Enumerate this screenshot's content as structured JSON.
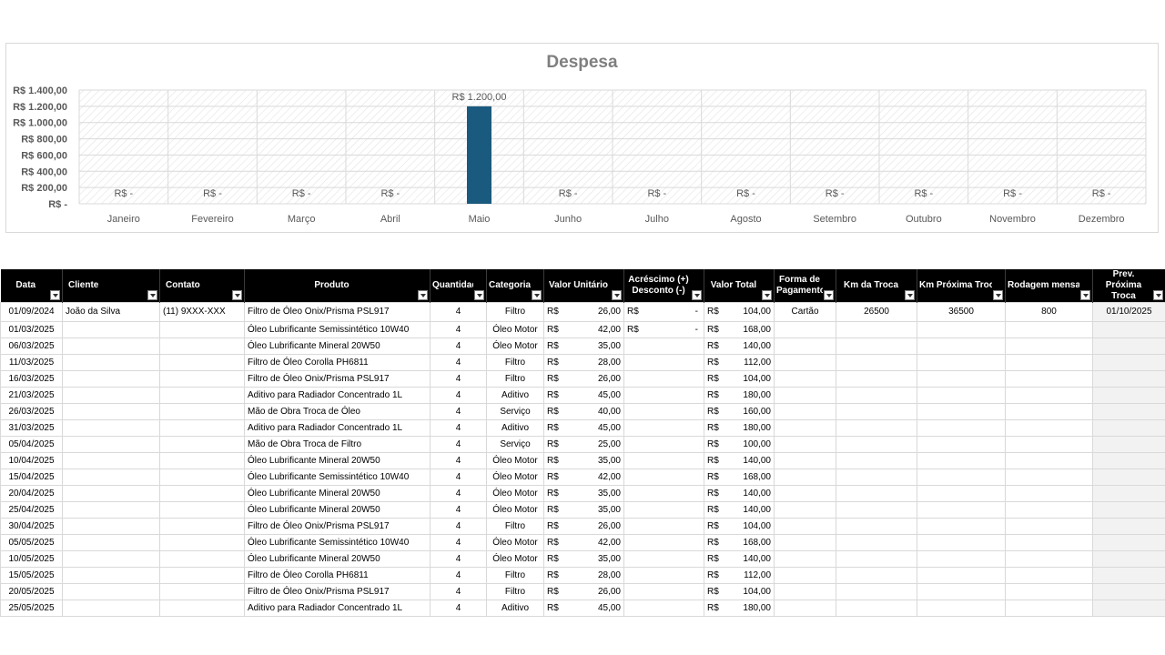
{
  "chart": {
    "title": "Despesa",
    "colors": {
      "bar": "#1a5a7e",
      "grid": "#d9d9d9",
      "text": "#595959",
      "title": "#7f7f7f"
    }
  },
  "chart_data": {
    "type": "bar",
    "title": "Despesa",
    "categories": [
      "Janeiro",
      "Fevereiro",
      "Março",
      "Abril",
      "Maio",
      "Junho",
      "Julho",
      "Agosto",
      "Setembro",
      "Outubro",
      "Novembro",
      "Dezembro"
    ],
    "values": [
      0,
      0,
      0,
      0,
      1200,
      0,
      0,
      0,
      0,
      0,
      0,
      0
    ],
    "data_labels": [
      "R$ -",
      "R$ -",
      "R$ -",
      "R$ -",
      "R$ 1.200,00",
      "R$ -",
      "R$ -",
      "R$ -",
      "R$ -",
      "R$ -",
      "R$ -",
      "R$ -"
    ],
    "y_ticks": [
      0,
      200,
      400,
      600,
      800,
      1000,
      1200,
      1400
    ],
    "y_tick_labels": [
      "R$ -",
      "R$ 200,00",
      "R$ 400,00",
      "R$ 600,00",
      "R$ 800,00",
      "R$ 1.000,00",
      "R$ 1.200,00",
      "R$ 1.400,00"
    ],
    "ylim": [
      0,
      1400
    ],
    "grid": true,
    "legend": "none"
  },
  "table": {
    "headers": [
      "Data",
      "Cliente",
      "Contato",
      "Produto",
      "Quantidade",
      "Categoria",
      "Valor Unitário",
      "Acréscimo (+) Desconto (-)",
      "Valor Total",
      "Forma de Pagamento",
      "Km da Troca",
      "Km Próxima Troca",
      "Rodagem mensal",
      "Prev. Próxima Troca"
    ],
    "currency": "R$",
    "rows": [
      {
        "data": "01/09/2024",
        "cliente": "João da Silva",
        "contato": "(11) 9XXX-XXX",
        "produto": "Filtro de Óleo Onix/Prisma PSL917",
        "quantidade": "4",
        "categoria": "Filtro",
        "unitario": "26,00",
        "ajuste": "-",
        "total": "104,00",
        "pagamento": "Cartão",
        "km_troca": "26500",
        "km_proxima": "36500",
        "rodagem": "800",
        "prev": "01/10/2025"
      },
      {
        "data": "01/03/2025",
        "cliente": "",
        "contato": "",
        "produto": "Óleo Lubrificante Semissintético 10W40",
        "quantidade": "4",
        "categoria": "Óleo Motor",
        "unitario": "42,00",
        "ajuste": "-",
        "total": "168,00",
        "pagamento": "",
        "km_troca": "",
        "km_proxima": "",
        "rodagem": "",
        "prev": ""
      },
      {
        "data": "06/03/2025",
        "cliente": "",
        "contato": "",
        "produto": "Óleo Lubrificante Mineral 20W50",
        "quantidade": "4",
        "categoria": "Óleo Motor",
        "unitario": "35,00",
        "ajuste": "",
        "total": "140,00",
        "pagamento": "",
        "km_troca": "",
        "km_proxima": "",
        "rodagem": "",
        "prev": ""
      },
      {
        "data": "11/03/2025",
        "cliente": "",
        "contato": "",
        "produto": "Filtro de Óleo Corolla PH6811",
        "quantidade": "4",
        "categoria": "Filtro",
        "unitario": "28,00",
        "ajuste": "",
        "total": "112,00",
        "pagamento": "",
        "km_troca": "",
        "km_proxima": "",
        "rodagem": "",
        "prev": ""
      },
      {
        "data": "16/03/2025",
        "cliente": "",
        "contato": "",
        "produto": "Filtro de Óleo Onix/Prisma PSL917",
        "quantidade": "4",
        "categoria": "Filtro",
        "unitario": "26,00",
        "ajuste": "",
        "total": "104,00",
        "pagamento": "",
        "km_troca": "",
        "km_proxima": "",
        "rodagem": "",
        "prev": ""
      },
      {
        "data": "21/03/2025",
        "cliente": "",
        "contato": "",
        "produto": "Aditivo para Radiador Concentrado 1L",
        "quantidade": "4",
        "categoria": "Aditivo",
        "unitario": "45,00",
        "ajuste": "",
        "total": "180,00",
        "pagamento": "",
        "km_troca": "",
        "km_proxima": "",
        "rodagem": "",
        "prev": ""
      },
      {
        "data": "26/03/2025",
        "cliente": "",
        "contato": "",
        "produto": "Mão de Obra Troca de Óleo",
        "quantidade": "4",
        "categoria": "Serviço",
        "unitario": "40,00",
        "ajuste": "",
        "total": "160,00",
        "pagamento": "",
        "km_troca": "",
        "km_proxima": "",
        "rodagem": "",
        "prev": ""
      },
      {
        "data": "31/03/2025",
        "cliente": "",
        "contato": "",
        "produto": "Aditivo para Radiador Concentrado 1L",
        "quantidade": "4",
        "categoria": "Aditivo",
        "unitario": "45,00",
        "ajuste": "",
        "total": "180,00",
        "pagamento": "",
        "km_troca": "",
        "km_proxima": "",
        "rodagem": "",
        "prev": ""
      },
      {
        "data": "05/04/2025",
        "cliente": "",
        "contato": "",
        "produto": "Mão de Obra Troca de Filtro",
        "quantidade": "4",
        "categoria": "Serviço",
        "unitario": "25,00",
        "ajuste": "",
        "total": "100,00",
        "pagamento": "",
        "km_troca": "",
        "km_proxima": "",
        "rodagem": "",
        "prev": ""
      },
      {
        "data": "10/04/2025",
        "cliente": "",
        "contato": "",
        "produto": "Óleo Lubrificante Mineral 20W50",
        "quantidade": "4",
        "categoria": "Óleo Motor",
        "unitario": "35,00",
        "ajuste": "",
        "total": "140,00",
        "pagamento": "",
        "km_troca": "",
        "km_proxima": "",
        "rodagem": "",
        "prev": ""
      },
      {
        "data": "15/04/2025",
        "cliente": "",
        "contato": "",
        "produto": "Óleo Lubrificante Semissintético 10W40",
        "quantidade": "4",
        "categoria": "Óleo Motor",
        "unitario": "42,00",
        "ajuste": "",
        "total": "168,00",
        "pagamento": "",
        "km_troca": "",
        "km_proxima": "",
        "rodagem": "",
        "prev": ""
      },
      {
        "data": "20/04/2025",
        "cliente": "",
        "contato": "",
        "produto": "Óleo Lubrificante Mineral 20W50",
        "quantidade": "4",
        "categoria": "Óleo Motor",
        "unitario": "35,00",
        "ajuste": "",
        "total": "140,00",
        "pagamento": "",
        "km_troca": "",
        "km_proxima": "",
        "rodagem": "",
        "prev": ""
      },
      {
        "data": "25/04/2025",
        "cliente": "",
        "contato": "",
        "produto": "Óleo Lubrificante Mineral 20W50",
        "quantidade": "4",
        "categoria": "Óleo Motor",
        "unitario": "35,00",
        "ajuste": "",
        "total": "140,00",
        "pagamento": "",
        "km_troca": "",
        "km_proxima": "",
        "rodagem": "",
        "prev": ""
      },
      {
        "data": "30/04/2025",
        "cliente": "",
        "contato": "",
        "produto": "Filtro de Óleo Onix/Prisma PSL917",
        "quantidade": "4",
        "categoria": "Filtro",
        "unitario": "26,00",
        "ajuste": "",
        "total": "104,00",
        "pagamento": "",
        "km_troca": "",
        "km_proxima": "",
        "rodagem": "",
        "prev": ""
      },
      {
        "data": "05/05/2025",
        "cliente": "",
        "contato": "",
        "produto": "Óleo Lubrificante Semissintético 10W40",
        "quantidade": "4",
        "categoria": "Óleo Motor",
        "unitario": "42,00",
        "ajuste": "",
        "total": "168,00",
        "pagamento": "",
        "km_troca": "",
        "km_proxima": "",
        "rodagem": "",
        "prev": ""
      },
      {
        "data": "10/05/2025",
        "cliente": "",
        "contato": "",
        "produto": "Óleo Lubrificante Mineral 20W50",
        "quantidade": "4",
        "categoria": "Óleo Motor",
        "unitario": "35,00",
        "ajuste": "",
        "total": "140,00",
        "pagamento": "",
        "km_troca": "",
        "km_proxima": "",
        "rodagem": "",
        "prev": ""
      },
      {
        "data": "15/05/2025",
        "cliente": "",
        "contato": "",
        "produto": "Filtro de Óleo Corolla PH6811",
        "quantidade": "4",
        "categoria": "Filtro",
        "unitario": "28,00",
        "ajuste": "",
        "total": "112,00",
        "pagamento": "",
        "km_troca": "",
        "km_proxima": "",
        "rodagem": "",
        "prev": ""
      },
      {
        "data": "20/05/2025",
        "cliente": "",
        "contato": "",
        "produto": "Filtro de Óleo Onix/Prisma PSL917",
        "quantidade": "4",
        "categoria": "Filtro",
        "unitario": "26,00",
        "ajuste": "",
        "total": "104,00",
        "pagamento": "",
        "km_troca": "",
        "km_proxima": "",
        "rodagem": "",
        "prev": ""
      },
      {
        "data": "25/05/2025",
        "cliente": "",
        "contato": "",
        "produto": "Aditivo para Radiador Concentrado 1L",
        "quantidade": "4",
        "categoria": "Aditivo",
        "unitario": "45,00",
        "ajuste": "",
        "total": "180,00",
        "pagamento": "",
        "km_troca": "",
        "km_proxima": "",
        "rodagem": "",
        "prev": ""
      }
    ]
  }
}
